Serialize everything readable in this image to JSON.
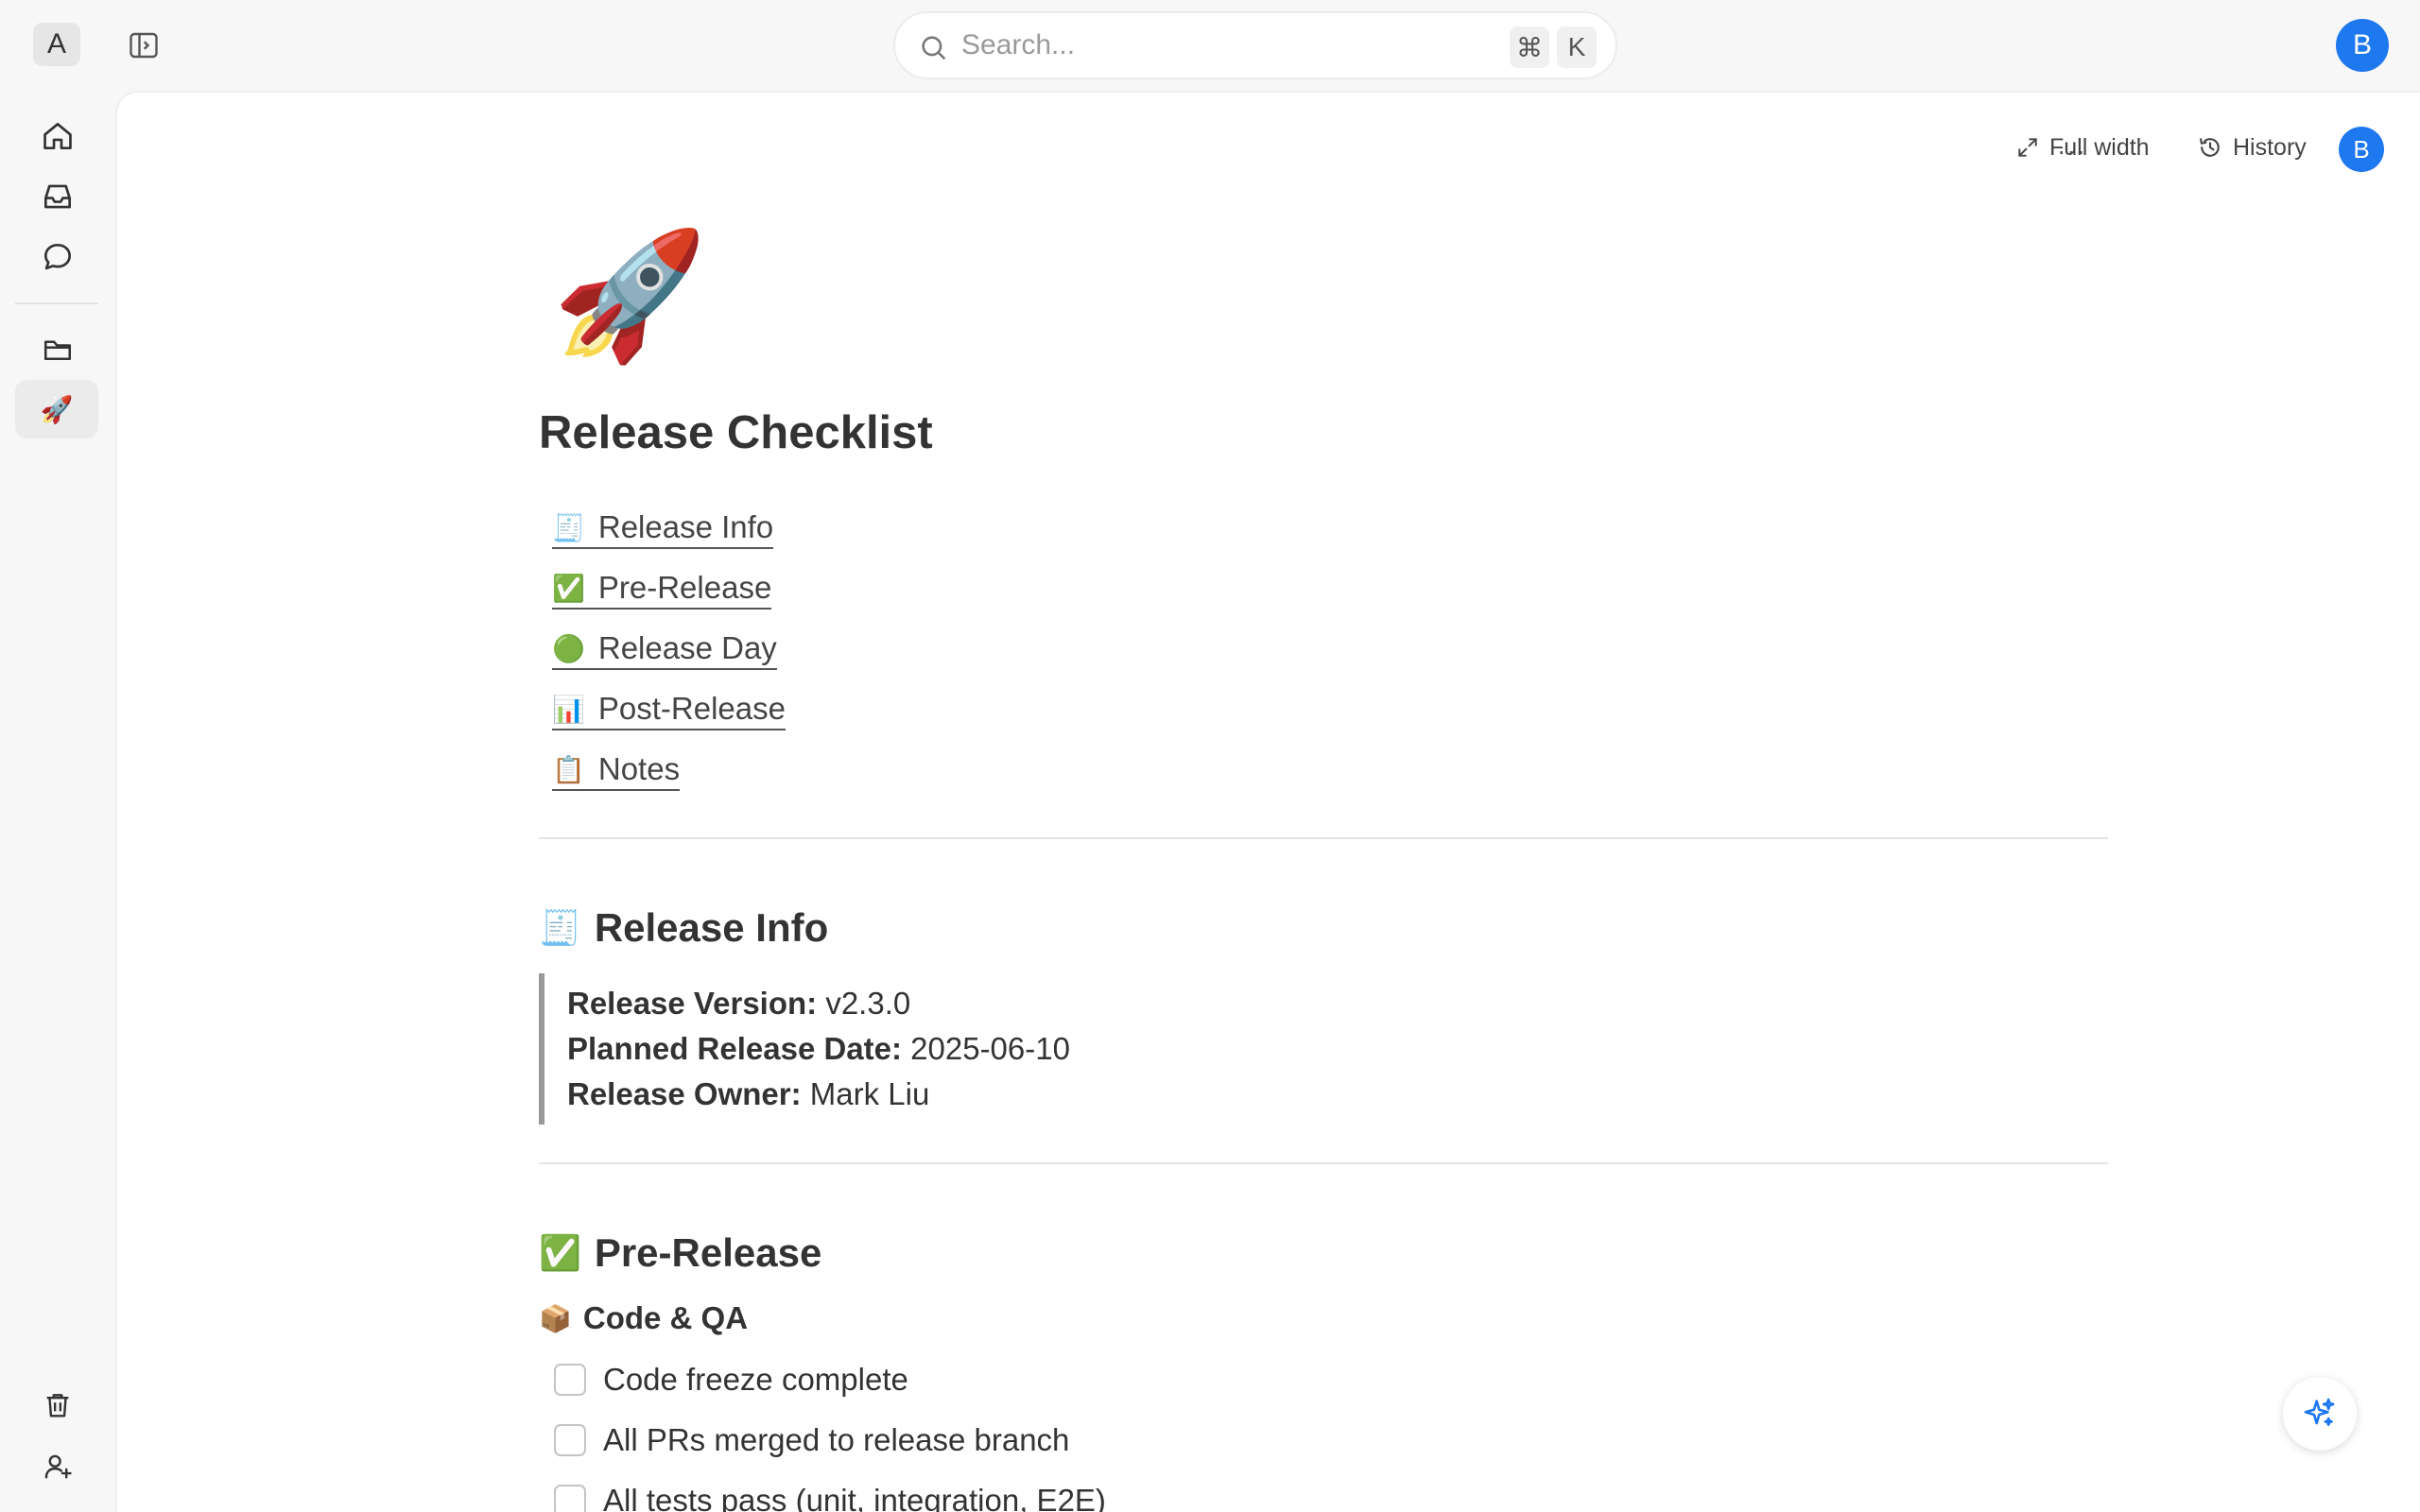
{
  "topbar": {
    "workspace_initial": "A",
    "search": {
      "placeholder": "Search...",
      "shortcut_cmd": "⌘",
      "shortcut_key": "K"
    },
    "user_initial": "B"
  },
  "rail": {
    "items": [
      {
        "icon": "home-icon"
      },
      {
        "icon": "inbox-icon"
      },
      {
        "icon": "chat-icon"
      },
      {
        "icon": "folder-icon"
      },
      {
        "icon": "rocket-page",
        "emoji": "🚀"
      }
    ],
    "bottom": [
      {
        "icon": "trash-icon"
      },
      {
        "icon": "add-user-icon"
      }
    ]
  },
  "doc_toolbar": {
    "more": "···",
    "full_width": "Full width",
    "history": "History",
    "avatar": "B"
  },
  "page": {
    "icon": "🚀",
    "title": "Release Checklist",
    "toc": [
      {
        "emoji": "🧾",
        "label": "Release Info"
      },
      {
        "emoji": "✅",
        "label": "Pre-Release"
      },
      {
        "emoji": "🟢",
        "label": "Release Day"
      },
      {
        "emoji": "📊",
        "label": "Post-Release"
      },
      {
        "emoji": "📋",
        "label": "Notes"
      }
    ],
    "release_info": {
      "emoji": "🧾",
      "heading": "Release Info",
      "version_label": "Release Version:",
      "version_value": "v2.3.0",
      "date_label": "Planned Release Date:",
      "date_value": "2025-06-10",
      "owner_label": "Release Owner:",
      "owner_value": "Mark Liu"
    },
    "pre_release": {
      "emoji": "✅",
      "heading": "Pre-Release",
      "subsection": {
        "emoji": "📦",
        "heading": "Code & QA"
      },
      "items": [
        {
          "label": "Code freeze complete",
          "checked": false
        },
        {
          "label": "All PRs merged to release branch",
          "checked": false
        },
        {
          "label": "All tests pass (unit, integration, E2E)",
          "checked": false
        }
      ]
    }
  },
  "colors": {
    "accent": "#1e78f0",
    "canvas": "#ffffff",
    "chrome": "#f7f7f7"
  }
}
